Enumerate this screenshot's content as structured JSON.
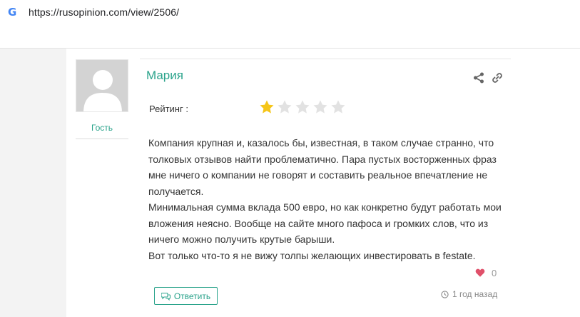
{
  "browser": {
    "url": "https://rusopinion.com/view/2506/",
    "favicon_letter": "G"
  },
  "review": {
    "author": "Мария",
    "author_role": "Гость",
    "rating_label": "Рейтинг :",
    "rating": 1,
    "rating_max": 5,
    "paragraphs": [
      "Компания крупная и, казалось бы, известная, в таком случае странно, что толковых отзывов найти проблематично. Пара пустых восторженных фраз мне ничего о компании не говорят и составить реальное впечатление не получается.",
      "Минимальная сумма вклада 500 евро, но как конкретно будут работать мои вложения неясно. Вообще на сайте много пафоса и громких слов, что из ничего можно получить крутые барыши.",
      "Вот только что-то я не вижу толпы желающих инвестировать в festate."
    ],
    "likes": "0",
    "reply_label": "Ответить",
    "time_ago": "1 год назад"
  },
  "colors": {
    "accent": "#2aa38b",
    "star_filled": "#f5c518",
    "star_empty": "#e2e2e2",
    "heart": "#e0506a"
  }
}
